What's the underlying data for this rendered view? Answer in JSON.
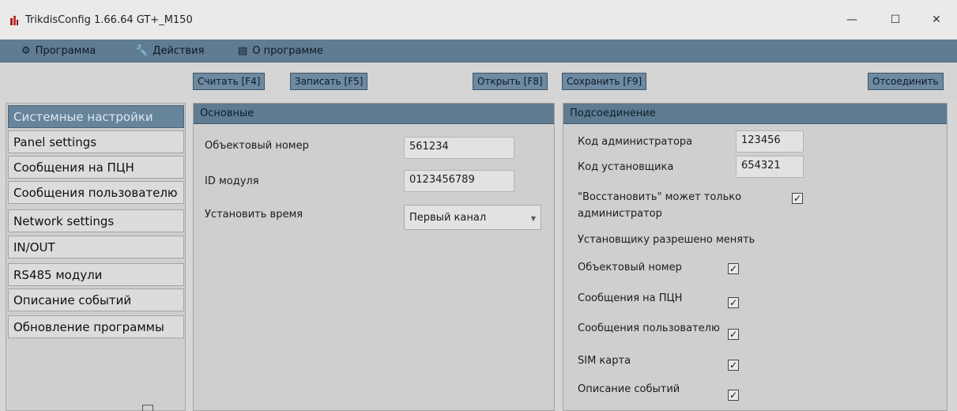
{
  "window": {
    "title": "TrikdisConfig 1.66.64  GT+_M150",
    "minimize_glyph": "—",
    "maximize_glyph": "☐",
    "close_glyph": "✕"
  },
  "menu": {
    "items": [
      {
        "label": "Программа",
        "icon": "gear-icon",
        "glyph": "⚙"
      },
      {
        "label": "Действия",
        "icon": "wrench-icon",
        "glyph": "🔧"
      },
      {
        "label": "О программе",
        "icon": "info-icon",
        "glyph": "▤"
      }
    ]
  },
  "toolbar": {
    "read": "Считать [F4]",
    "write": "Записать [F5]",
    "open": "Открыть [F8]",
    "save": "Сохранить [F9]",
    "disconnect": "Отсоединить"
  },
  "sidebar": {
    "items": [
      {
        "label": "Системные настройки",
        "active": true
      },
      {
        "label": "Panel settings"
      },
      {
        "label": "Сообщения на ПЦН"
      },
      {
        "label": "Сообщения пользователю"
      },
      {
        "label": "Network settings"
      },
      {
        "label": "IN/OUT"
      },
      {
        "label": "RS485 модули"
      },
      {
        "label": "Описание событий"
      },
      {
        "label": "Обновление программы"
      }
    ]
  },
  "basic": {
    "header": "Основные",
    "object_number_label": "Объектовый номер",
    "object_number_value": "561234",
    "module_id_label": "ID модуля",
    "module_id_value": "0123456789",
    "set_time_label": "Установить время",
    "set_time_value": "Первый канал"
  },
  "connection": {
    "header": "Подсоединение",
    "admin_code_label": "Код администратора",
    "admin_code_value": "123456",
    "installer_code_label": "Код установщика",
    "installer_code_value": "654321",
    "restore_label_line1": "\"Восстановить\" может только",
    "restore_label_line2": "администратор",
    "restore_checked": true,
    "installer_allowed_label": "Установщику разрешено менять",
    "permissions": [
      {
        "label": "Объектовый номер",
        "checked": true
      },
      {
        "label": "Сообщения на ПЦН",
        "checked": true
      },
      {
        "label": "Сообщения пользователю",
        "checked": true
      },
      {
        "label": "SIM карта",
        "checked": true
      },
      {
        "label": "Описание событий",
        "checked": true
      }
    ],
    "check_glyph": "✓"
  },
  "colors": {
    "accent": "#5e7b91",
    "active_item": "#66849a",
    "window_bg": "#d6d6d6"
  }
}
